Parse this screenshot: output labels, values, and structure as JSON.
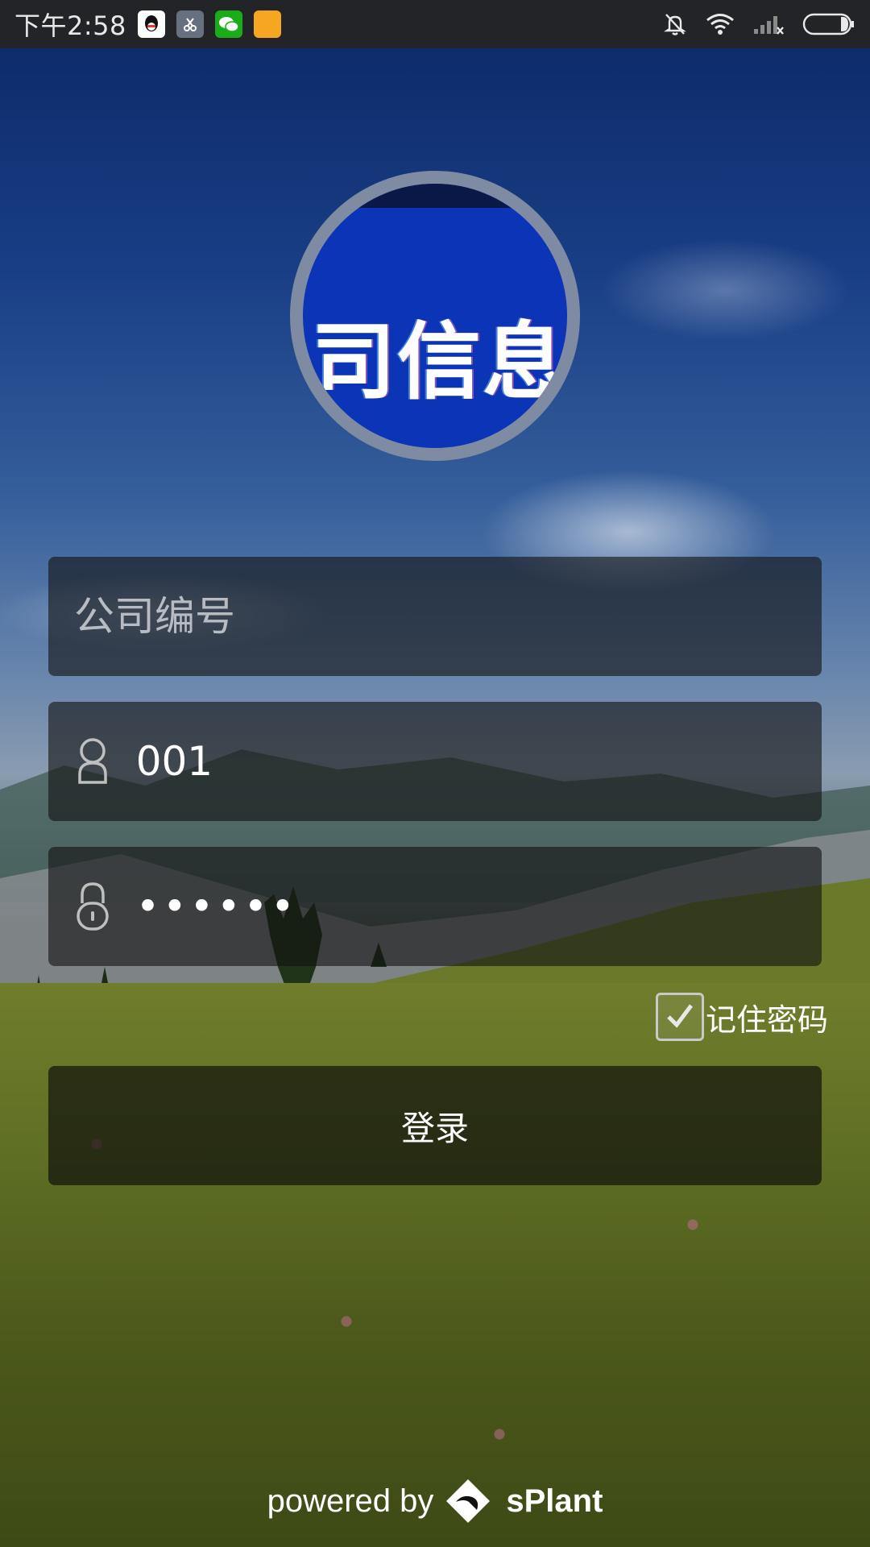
{
  "status_bar": {
    "time": "下午2:58",
    "apps": [
      "qq-icon",
      "scissors-app-icon",
      "wechat-icon",
      "notes-app-icon"
    ],
    "right_icons": [
      "silent-bell-icon",
      "wifi-icon",
      "signal-icon",
      "battery-icon"
    ]
  },
  "logo": {
    "text": "司信息"
  },
  "form": {
    "company_placeholder": "公司编号",
    "company_value": "",
    "username_value": "001",
    "password_value": "••••••",
    "remember_label": "记住密码",
    "remember_checked": true,
    "login_label": "登录"
  },
  "footer": {
    "prefix": "powered by",
    "brand": "sPlant"
  },
  "colors": {
    "status_bar": "#222428",
    "logo_blue": "#0b34b6",
    "ring": "#7e8ba3",
    "field_bg": "rgba(20,20,20,0.62)"
  }
}
